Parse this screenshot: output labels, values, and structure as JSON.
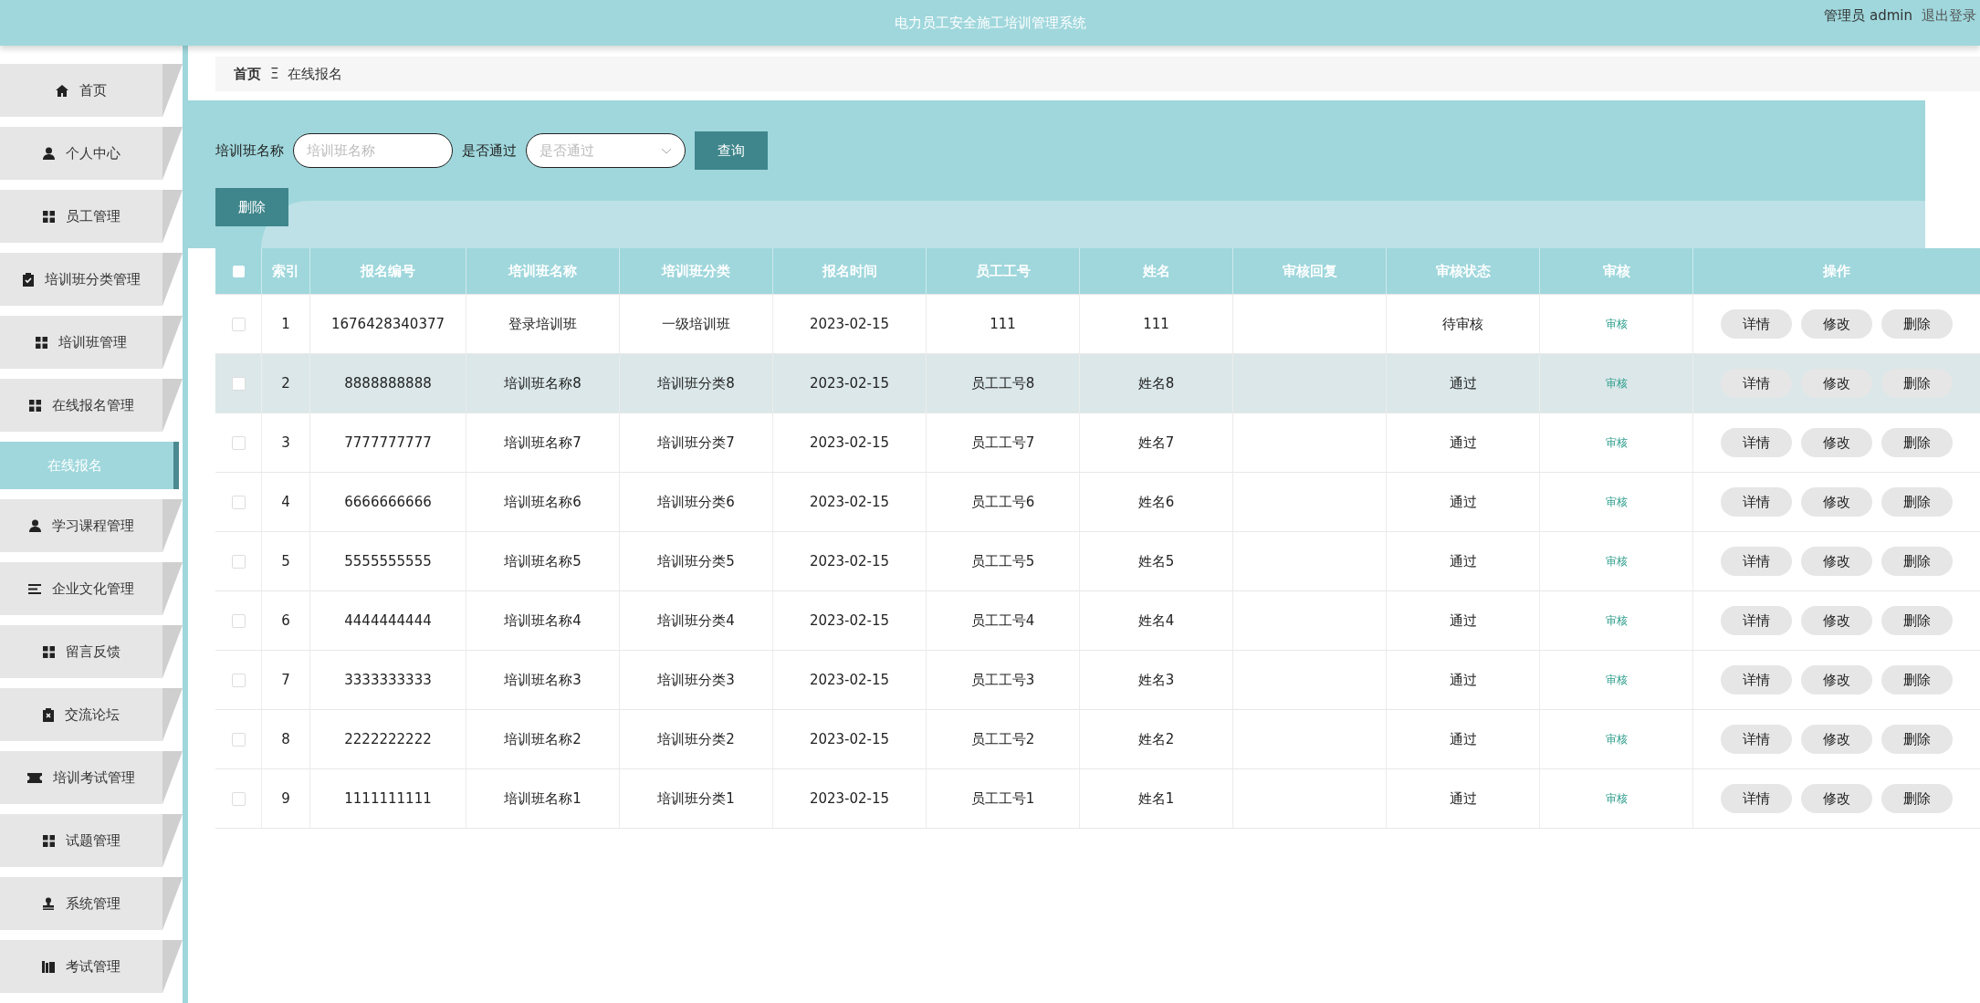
{
  "header": {
    "title": "电力员工安全施工培训管理系统",
    "user": "管理员 admin",
    "logout": "退出登录"
  },
  "sidebar": {
    "items": [
      {
        "label": "首页",
        "selected": false
      },
      {
        "label": "个人中心",
        "selected": false
      },
      {
        "label": "员工管理",
        "selected": false
      },
      {
        "label": "培训班分类管理",
        "selected": false
      },
      {
        "label": "培训班管理",
        "selected": false
      },
      {
        "label": "在线报名管理",
        "selected": false
      },
      {
        "label": "在线报名",
        "selected": true
      },
      {
        "label": "学习课程管理",
        "selected": false
      },
      {
        "label": "企业文化管理",
        "selected": false
      },
      {
        "label": "留言反馈",
        "selected": false
      },
      {
        "label": "交流论坛",
        "selected": false
      },
      {
        "label": "培训考试管理",
        "selected": false
      },
      {
        "label": "试题管理",
        "selected": false
      },
      {
        "label": "系统管理",
        "selected": false
      },
      {
        "label": "考试管理",
        "selected": false
      }
    ]
  },
  "breadcrumb": {
    "home": "首页",
    "separator": "Ξ",
    "current": "在线报名"
  },
  "search": {
    "name_label": "培训班名称",
    "name_placeholder": "培训班名称",
    "pass_label": "是否通过",
    "pass_placeholder": "是否通过",
    "query_button": "查询"
  },
  "delete_button": "删除",
  "table": {
    "columns": [
      "索引",
      "报名编号",
      "培训班名称",
      "培训班分类",
      "报名时间",
      "员工工号",
      "姓名",
      "审核回复",
      "审核状态",
      "审核",
      "操作"
    ],
    "all_checked": false,
    "rows": [
      {
        "checked": false,
        "hovered": false,
        "cells": [
          "1",
          "1676428340377",
          "登录培训班",
          "一级培训班",
          "2023-02-15",
          "111",
          "111",
          "",
          "待审核"
        ],
        "review": "审核",
        "actions": [
          "详情",
          "修改",
          "删除"
        ]
      },
      {
        "checked": false,
        "hovered": true,
        "cells": [
          "2",
          "8888888888",
          "培训班名称8",
          "培训班分类8",
          "2023-02-15",
          "员工工号8",
          "姓名8",
          "",
          "通过"
        ],
        "review": "审核",
        "actions": [
          "详情",
          "修改",
          "删除"
        ]
      },
      {
        "checked": false,
        "hovered": false,
        "cells": [
          "3",
          "7777777777",
          "培训班名称7",
          "培训班分类7",
          "2023-02-15",
          "员工工号7",
          "姓名7",
          "",
          "通过"
        ],
        "review": "审核",
        "actions": [
          "详情",
          "修改",
          "删除"
        ]
      },
      {
        "checked": false,
        "hovered": false,
        "cells": [
          "4",
          "6666666666",
          "培训班名称6",
          "培训班分类6",
          "2023-02-15",
          "员工工号6",
          "姓名6",
          "",
          "通过"
        ],
        "review": "审核",
        "actions": [
          "详情",
          "修改",
          "删除"
        ]
      },
      {
        "checked": false,
        "hovered": false,
        "cells": [
          "5",
          "5555555555",
          "培训班名称5",
          "培训班分类5",
          "2023-02-15",
          "员工工号5",
          "姓名5",
          "",
          "通过"
        ],
        "review": "审核",
        "actions": [
          "详情",
          "修改",
          "删除"
        ]
      },
      {
        "checked": false,
        "hovered": false,
        "cells": [
          "6",
          "4444444444",
          "培训班名称4",
          "培训班分类4",
          "2023-02-15",
          "员工工号4",
          "姓名4",
          "",
          "通过"
        ],
        "review": "审核",
        "actions": [
          "详情",
          "修改",
          "删除"
        ]
      },
      {
        "checked": false,
        "hovered": false,
        "cells": [
          "7",
          "3333333333",
          "培训班名称3",
          "培训班分类3",
          "2023-02-15",
          "员工工号3",
          "姓名3",
          "",
          "通过"
        ],
        "review": "审核",
        "actions": [
          "详情",
          "修改",
          "删除"
        ]
      },
      {
        "checked": false,
        "hovered": false,
        "cells": [
          "8",
          "2222222222",
          "培训班名称2",
          "培训班分类2",
          "2023-02-15",
          "员工工号2",
          "姓名2",
          "",
          "通过"
        ],
        "review": "审核",
        "actions": [
          "详情",
          "修改",
          "删除"
        ]
      },
      {
        "checked": false,
        "hovered": false,
        "cells": [
          "9",
          "1111111111",
          "培训班名称1",
          "培训班分类1",
          "2023-02-15",
          "员工工号1",
          "姓名1",
          "",
          "通过"
        ],
        "review": "审核",
        "actions": [
          "详情",
          "修改",
          "删除"
        ]
      }
    ]
  }
}
